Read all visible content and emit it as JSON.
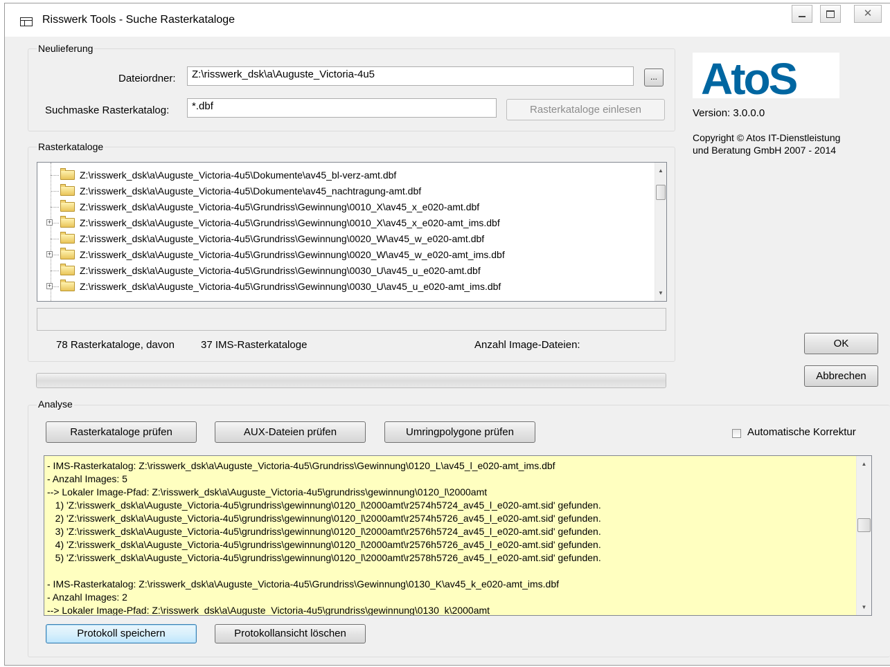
{
  "window": {
    "title": "Risswerk Tools - Suche Rasterkataloge",
    "controls": [
      "minimize-icon",
      "maximize-icon",
      "close-icon"
    ]
  },
  "neulieferung": {
    "group_label": "Neulieferung",
    "dateiordner_label": "Dateiordner:",
    "dateiordner_value": "Z:\\risswerk_dsk\\a\\Auguste_Victoria-4u5",
    "browse_label": "...",
    "suchmaske_label": "Suchmaske Rasterkatalog:",
    "suchmaske_value": "*.dbf",
    "einlesen_label": "Rasterkataloge einlesen"
  },
  "rasterkataloge": {
    "group_label": "Rasterkataloge",
    "items": [
      {
        "path": "Z:\\risswerk_dsk\\a\\Auguste_Victoria-4u5\\Dokumente\\av45_bl-verz-amt.dbf",
        "expandable": false
      },
      {
        "path": "Z:\\risswerk_dsk\\a\\Auguste_Victoria-4u5\\Dokumente\\av45_nachtragung-amt.dbf",
        "expandable": false
      },
      {
        "path": "Z:\\risswerk_dsk\\a\\Auguste_Victoria-4u5\\Grundriss\\Gewinnung\\0010_X\\av45_x_e020-amt.dbf",
        "expandable": false
      },
      {
        "path": "Z:\\risswerk_dsk\\a\\Auguste_Victoria-4u5\\Grundriss\\Gewinnung\\0010_X\\av45_x_e020-amt_ims.dbf",
        "expandable": true
      },
      {
        "path": "Z:\\risswerk_dsk\\a\\Auguste_Victoria-4u5\\Grundriss\\Gewinnung\\0020_W\\av45_w_e020-amt.dbf",
        "expandable": false
      },
      {
        "path": "Z:\\risswerk_dsk\\a\\Auguste_Victoria-4u5\\Grundriss\\Gewinnung\\0020_W\\av45_w_e020-amt_ims.dbf",
        "expandable": true
      },
      {
        "path": "Z:\\risswerk_dsk\\a\\Auguste_Victoria-4u5\\Grundriss\\Gewinnung\\0030_U\\av45_u_e020-amt.dbf",
        "expandable": false
      },
      {
        "path": "Z:\\risswerk_dsk\\a\\Auguste_Victoria-4u5\\Grundriss\\Gewinnung\\0030_U\\av45_u_e020-amt_ims.dbf",
        "expandable": true
      }
    ],
    "count_text": "78 Rasterkataloge, davon",
    "ims_text": "37 IMS-Rasterkataloge",
    "image_count_label": "Anzahl Image-Dateien:"
  },
  "about": {
    "logo_text": "AtoS",
    "version": "Version: 3.0.0.0",
    "copyright_line1": "Copyright © Atos IT-Dienstleistung",
    "copyright_line2": "und Beratung GmbH 2007 - 2014",
    "logo_color": "#0066a1"
  },
  "dialog_buttons": {
    "ok_label": "OK",
    "cancel_label": "Abbrechen"
  },
  "analyse": {
    "group_label": "Analyse",
    "btn_rasterkataloge": "Rasterkataloge prüfen",
    "btn_aux": "AUX-Dateien prüfen",
    "btn_umring": "Umringpolygone prüfen",
    "auto_korrektur_label": "Automatische Korrektur",
    "auto_korrektur_checked": false,
    "log_lines": [
      "- IMS-Rasterkatalog: Z:\\risswerk_dsk\\a\\Auguste_Victoria-4u5\\Grundriss\\Gewinnung\\0120_L\\av45_l_e020-amt_ims.dbf",
      "- Anzahl Images: 5",
      "--> Lokaler Image-Pfad: Z:\\risswerk_dsk\\a\\Auguste_Victoria-4u5\\grundriss\\gewinnung\\0120_l\\2000amt",
      "   1) 'Z:\\risswerk_dsk\\a\\Auguste_Victoria-4u5\\grundriss\\gewinnung\\0120_l\\2000amt\\r2574h5724_av45_l_e020-amt.sid' gefunden.",
      "   2) 'Z:\\risswerk_dsk\\a\\Auguste_Victoria-4u5\\grundriss\\gewinnung\\0120_l\\2000amt\\r2574h5726_av45_l_e020-amt.sid' gefunden.",
      "   3) 'Z:\\risswerk_dsk\\a\\Auguste_Victoria-4u5\\grundriss\\gewinnung\\0120_l\\2000amt\\r2576h5724_av45_l_e020-amt.sid' gefunden.",
      "   4) 'Z:\\risswerk_dsk\\a\\Auguste_Victoria-4u5\\grundriss\\gewinnung\\0120_l\\2000amt\\r2576h5726_av45_l_e020-amt.sid' gefunden.",
      "   5) 'Z:\\risswerk_dsk\\a\\Auguste_Victoria-4u5\\grundriss\\gewinnung\\0120_l\\2000amt\\r2578h5726_av45_l_e020-amt.sid' gefunden.",
      "",
      "- IMS-Rasterkatalog: Z:\\risswerk_dsk\\a\\Auguste_Victoria-4u5\\Grundriss\\Gewinnung\\0130_K\\av45_k_e020-amt_ims.dbf",
      "- Anzahl Images: 2",
      "--> Lokaler Image-Pfad: Z:\\risswerk_dsk\\a\\Auguste_Victoria-4u5\\grundriss\\gewinnung\\0130_k\\2000amt"
    ],
    "log_background": "#ffffc0",
    "btn_protokoll_speichern": "Protokoll speichern",
    "btn_protokoll_loeschen": "Protokollansicht löschen"
  }
}
